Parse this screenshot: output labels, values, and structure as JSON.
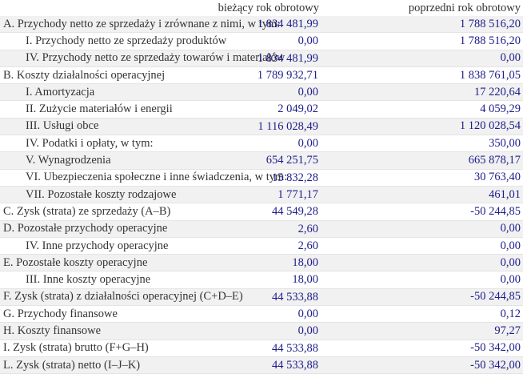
{
  "columns": {
    "label": "",
    "current": "bieżący rok obrotowy",
    "previous": "poprzedni rok obrotowy"
  },
  "colors": {
    "value": "#1c1c8c",
    "row_shade": "#f1f1f1"
  },
  "rows": [
    {
      "label": "A. Przychody netto ze sprzedaży i zrównane z nimi, w tym:",
      "current": "1 834 481,99",
      "previous": "1 788 516,20",
      "level": 0
    },
    {
      "label": "I. Przychody netto ze sprzedaży produktów",
      "current": "0,00",
      "previous": "1 788 516,20",
      "level": 1
    },
    {
      "label": "IV. Przychody netto ze sprzedaży towarów i materiałów",
      "current": "1 834 481,99",
      "previous": "0,00",
      "level": 1
    },
    {
      "label": "B. Koszty działalności operacyjnej",
      "current": "1 789 932,71",
      "previous": "1 838 761,05",
      "level": 0
    },
    {
      "label": "I. Amortyzacja",
      "current": "0,00",
      "previous": "17 220,64",
      "level": 1
    },
    {
      "label": "II. Zużycie materiałów i energii",
      "current": "2 049,02",
      "previous": "4 059,29",
      "level": 1
    },
    {
      "label": "III. Usługi obce",
      "current": "1 116 028,49",
      "previous": "1 120 028,54",
      "level": 1
    },
    {
      "label": "IV. Podatki i opłaty, w tym:",
      "current": "0,00",
      "previous": "350,00",
      "level": 1
    },
    {
      "label": "V. Wynagrodzenia",
      "current": "654 251,75",
      "previous": "665 878,17",
      "level": 1
    },
    {
      "label": "VI. Ubezpieczenia społeczne i inne świadczenia, w tym:",
      "current": "15 832,28",
      "previous": "30 763,40",
      "level": 1
    },
    {
      "label": "VII. Pozostałe koszty rodzajowe",
      "current": "1 771,17",
      "previous": "461,01",
      "level": 1
    },
    {
      "label": "C. Zysk (strata) ze sprzedaży (A–B)",
      "current": "44 549,28",
      "previous": "-50 244,85",
      "level": 0
    },
    {
      "label": "D. Pozostałe przychody operacyjne",
      "current": "2,60",
      "previous": "0,00",
      "level": 0
    },
    {
      "label": "IV. Inne przychody operacyjne",
      "current": "2,60",
      "previous": "0,00",
      "level": 1
    },
    {
      "label": "E. Pozostałe koszty operacyjne",
      "current": "18,00",
      "previous": "0,00",
      "level": 0
    },
    {
      "label": "III. Inne koszty operacyjne",
      "current": "18,00",
      "previous": "0,00",
      "level": 1
    },
    {
      "label": "F. Zysk (strata) z działalności operacyjnej (C+D–E)",
      "current": "44 533,88",
      "previous": "-50 244,85",
      "level": 0
    },
    {
      "label": "G. Przychody finansowe",
      "current": "0,00",
      "previous": "0,12",
      "level": 0
    },
    {
      "label": "H. Koszty finansowe",
      "current": "0,00",
      "previous": "97,27",
      "level": 0
    },
    {
      "label": "I. Zysk (strata) brutto (F+G–H)",
      "current": "44 533,88",
      "previous": "-50 342,00",
      "level": 0
    },
    {
      "label": "L. Zysk (strata) netto (I–J–K)",
      "current": "44 533,88",
      "previous": "-50 342,00",
      "level": 0
    }
  ]
}
